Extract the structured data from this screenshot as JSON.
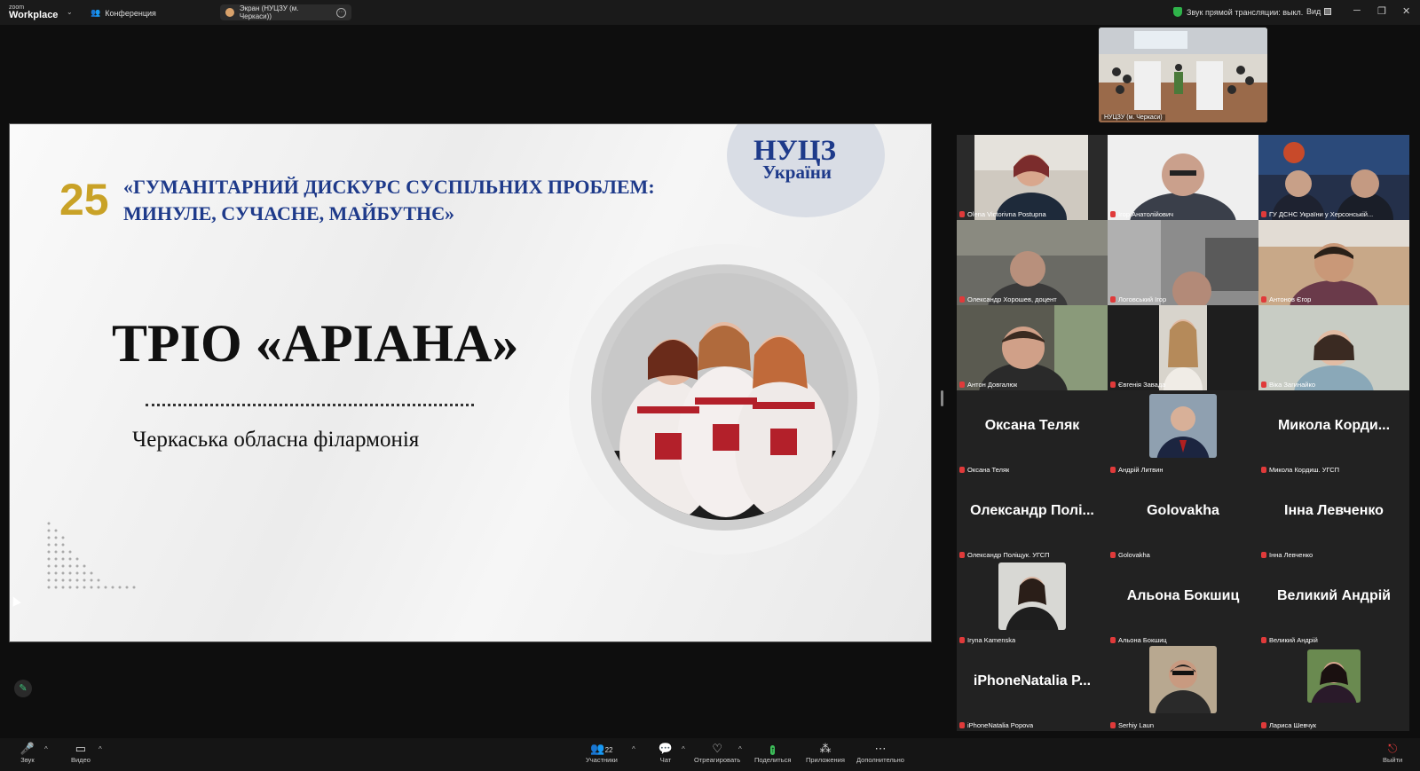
{
  "topbar": {
    "brand_small": "zoom",
    "brand_main": "Workplace",
    "conference_label": "Конференция",
    "screen_label": "Экран (НУЦЗУ (м. Черкаси))",
    "audio_status": "Звук прямой трансляции: выкл.",
    "view_label": "Вид"
  },
  "slide": {
    "number": "25",
    "conference_title_line1": "«ГУМАНІТАРНИЙ ДИСКУРС СУСПІЛЬНИХ ПРОБЛЕМ:",
    "conference_title_line2": "МИНУЛЕ, СУЧАСНЕ, МАЙБУТНЄ»",
    "logo_line1": "НУЦЗ",
    "logo_line2": "України",
    "headline": "ТРІО «АРІАНА»",
    "subtitle": "Черкаська обласна філармонія"
  },
  "featured": {
    "name": "НУЦЗУ (м. Черкаси)"
  },
  "participants": [
    {
      "label": "Olena Victorivna Postupna",
      "video": true
    },
    {
      "label": "Ігор Анатолійович",
      "video": true
    },
    {
      "label": "ГУ ДСНС України у Херсонській...",
      "video": true
    },
    {
      "label": "Олександр Хорошев, доцент",
      "video": true
    },
    {
      "label": "Логовський Ігор",
      "video": true
    },
    {
      "label": "Антонов Єгор",
      "video": true
    },
    {
      "label": "Антон Довгалюк",
      "video": true
    },
    {
      "label": "Євгенія Завада",
      "video": true
    },
    {
      "label": "Віка Загинайко",
      "video": true
    },
    {
      "big": "Оксана Теляк",
      "label": "Оксана Теляк"
    },
    {
      "label": "Андрій Литвин",
      "avatar": true
    },
    {
      "big": "Микола Корди...",
      "label": "Микола Кордиш. УГСП"
    },
    {
      "big": "Олександр Полі...",
      "label": "Олександр Поліщук. УГСП"
    },
    {
      "big": "Golovakha",
      "label": "Golovakha"
    },
    {
      "big": "Інна Левченко",
      "label": "Інна Левченко"
    },
    {
      "label": "Iryna Kamenska",
      "avatar": true
    },
    {
      "big": "Альона Бокшиц",
      "label": "Альона Бокшиц"
    },
    {
      "big": "Великий Андрій",
      "label": "Великий Андрій"
    },
    {
      "big": "iPhoneNatalia P...",
      "label": "iPhoneNatalia Popova"
    },
    {
      "label": "Serhiy Laun",
      "avatar": true
    },
    {
      "label": "Лариса Шевчук",
      "avatar": true
    }
  ],
  "toolbar": {
    "audio": "Звук",
    "video": "Видео",
    "participants": "Участники",
    "participants_count": "22",
    "chat": "Чат",
    "react": "Отреагировать",
    "share": "Поделиться",
    "apps": "Приложения",
    "more": "Дополнительно",
    "leave": "Выйти"
  },
  "colors": {
    "accent_green": "#3dbf5a",
    "muted_red": "#e03a3a",
    "slide_blue": "#1e3a8a",
    "slide_gold": "#c9a227"
  }
}
